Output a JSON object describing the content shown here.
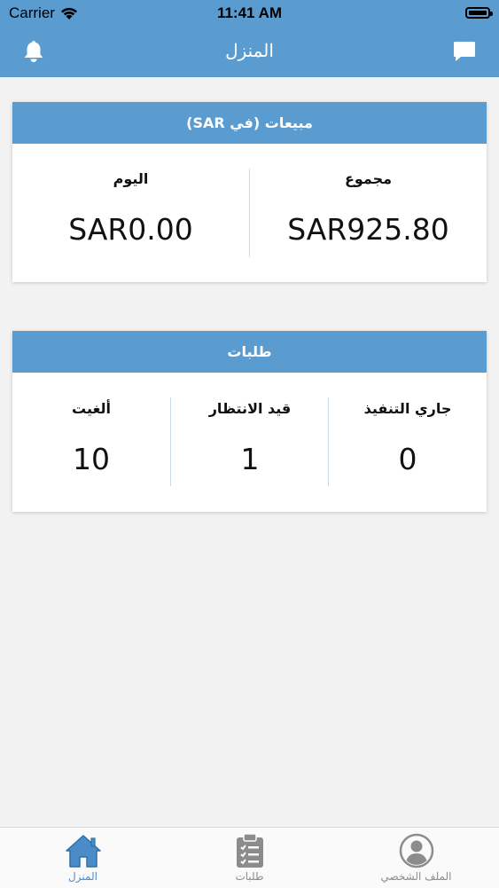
{
  "status": {
    "carrier": "Carrier",
    "time": "11:41 AM"
  },
  "header": {
    "title": "المنزل",
    "left_icon": "bell-icon",
    "right_icon": "chat-bubble-icon"
  },
  "sales": {
    "title": "مبيعات (في SAR)",
    "total_label": "مجموع",
    "total_value": "SAR925.80",
    "today_label": "اليوم",
    "today_value": "SAR0.00"
  },
  "orders": {
    "title": "طلبات",
    "in_progress_label": "جاري التنفيذ",
    "in_progress_value": "0",
    "pending_label": "قيد الانتظار",
    "pending_value": "1",
    "cancelled_label": "ألغيت",
    "cancelled_value": "10"
  },
  "tabs": [
    {
      "label": "الملف الشخصي",
      "icon": "profile-icon"
    },
    {
      "label": "طلبات",
      "icon": "clipboard-list-icon"
    },
    {
      "label": "المنزل",
      "icon": "home-icon",
      "active": true
    }
  ],
  "colors": {
    "primary": "#5a9bd0",
    "tab_active": "#4a8cc8",
    "tab_inactive": "#8c8c8c"
  }
}
